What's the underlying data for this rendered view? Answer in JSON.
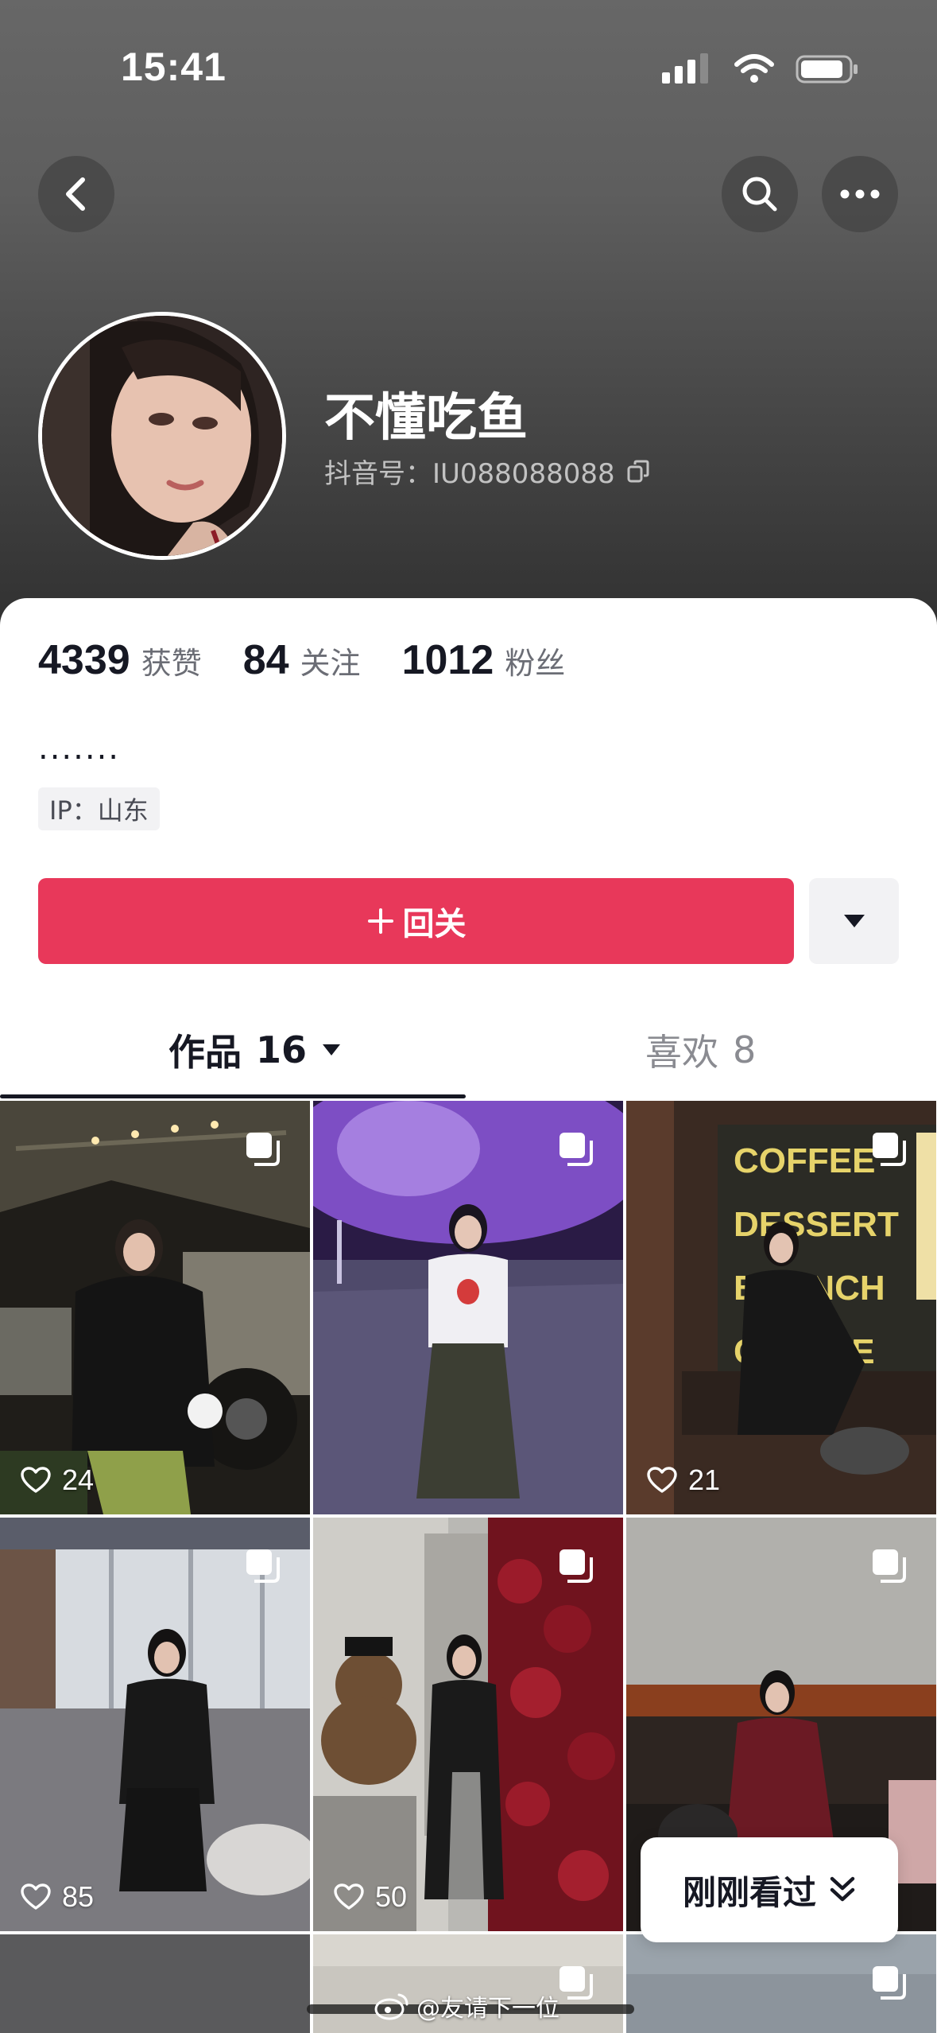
{
  "status_bar": {
    "time": "15:41"
  },
  "profile": {
    "nickname": "不懂吃鱼",
    "douyin_id": "抖音号：IU088088088",
    "bio": ".......",
    "ip": "IP：山东"
  },
  "stats": [
    {
      "value": "4339",
      "label": "获赞"
    },
    {
      "value": "84",
      "label": "关注"
    },
    {
      "value": "1012",
      "label": "粉丝"
    }
  ],
  "actions": {
    "follow_back": "回关"
  },
  "tabs": {
    "works": {
      "label": "作品",
      "count": "16"
    },
    "likes": {
      "label": "喜欢",
      "count": "8"
    }
  },
  "videos": [
    {
      "likes": "24"
    },
    {
      "likes": ""
    },
    {
      "likes": "21"
    },
    {
      "likes": "85"
    },
    {
      "likes": "50"
    },
    {
      "likes": ""
    }
  ],
  "recent_viewed": "刚刚看过",
  "watermark": "@友请下一位",
  "colors": {
    "accent": "#e8385a",
    "header_bg": "#5e5e5e",
    "text": "#161823"
  }
}
